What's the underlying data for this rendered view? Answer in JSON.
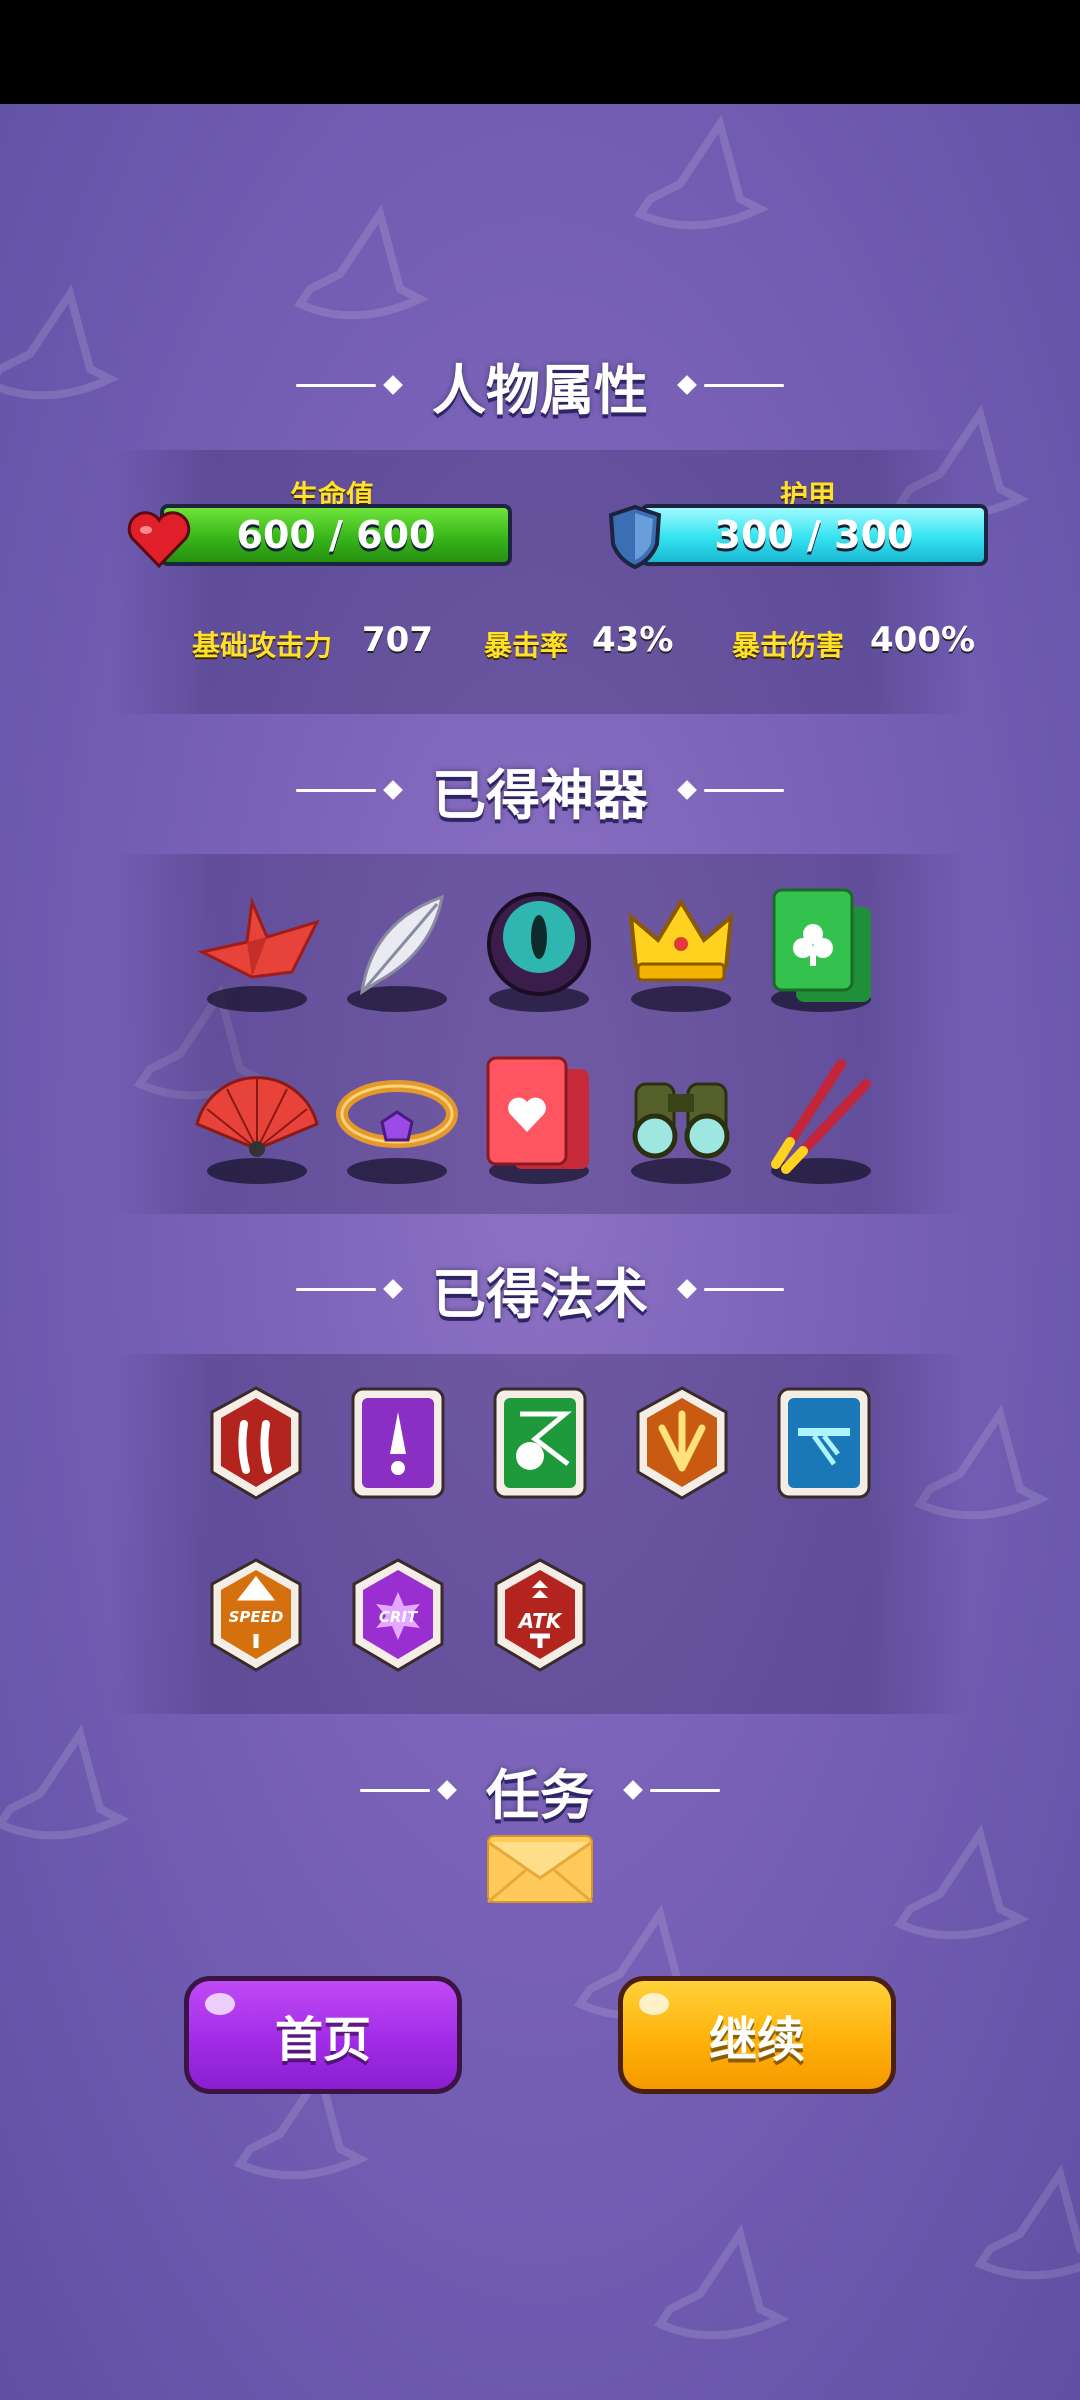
{
  "sections": {
    "attributes": "人物属性",
    "artifacts": "已得神器",
    "spells": "已得法术",
    "tasks": "任务"
  },
  "hp": {
    "label": "生命值",
    "value": "600 / 600"
  },
  "armor": {
    "label": "护甲",
    "value": "300 / 300"
  },
  "stats": [
    {
      "label": "基础攻击力",
      "value": "707"
    },
    {
      "label": "暴击率",
      "value": "43%"
    },
    {
      "label": "暴击伤害",
      "value": "400%"
    }
  ],
  "artifacts": [
    "paper-crane",
    "feather",
    "eye-orb",
    "golden-crown",
    "club-card",
    "folding-fan",
    "gem-bracelet",
    "heart-card",
    "binoculars",
    "chopsticks"
  ],
  "spells": [
    "claw-strike",
    "drop-spell",
    "skull-arrow",
    "fire-burst",
    "laser-beam",
    "speed-up",
    "crit-up",
    "atk-up"
  ],
  "speed_text": "SPEED",
  "crit_text": "CRIT",
  "atk_text": "ATK",
  "buttons": {
    "home": "首页",
    "continue": "继续"
  },
  "colors": {
    "hp": "#3fbf1f",
    "armor": "#2fe0ee",
    "home": "#a02ee6",
    "continue": "#ffb10a",
    "label": "#ffe02a"
  }
}
